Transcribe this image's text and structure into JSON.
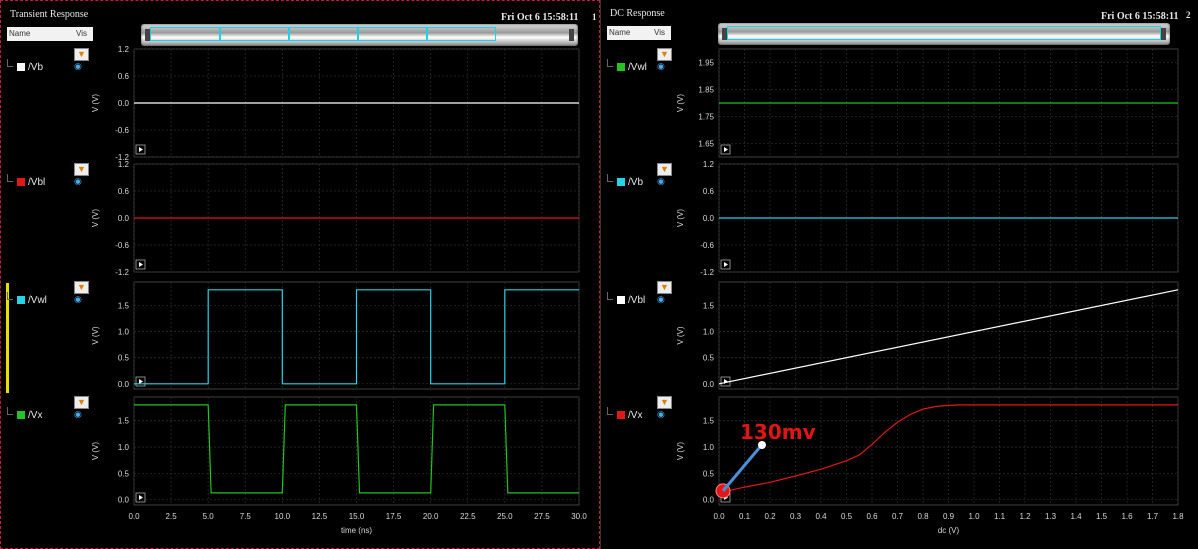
{
  "left": {
    "title": "Transient Response",
    "date": "Fri Oct 6 15:58:11",
    "header_name": "Name",
    "header_vis": "Vis",
    "signals": [
      {
        "name": "/Vb",
        "color": "#ffffff"
      },
      {
        "name": "/Vbl",
        "color": "#e01818"
      },
      {
        "name": "/Vwl",
        "color": "#27d3e6"
      },
      {
        "name": "/Vx",
        "color": "#21c421"
      }
    ]
  },
  "right": {
    "title": "DC Response",
    "date": "Fri Oct 6 15:58:11",
    "header_name": "Name",
    "header_vis": "Vis",
    "signals": [
      {
        "name": "/Vwl",
        "color": "#21c421"
      },
      {
        "name": "/Vb",
        "color": "#27d3e6"
      },
      {
        "name": "/Vbl",
        "color": "#ffffff"
      },
      {
        "name": "/Vx",
        "color": "#e01818"
      }
    ]
  },
  "divider_label": "1",
  "corner_label": "2",
  "annotation": "130mv",
  "chart_data": [
    {
      "type": "line",
      "title": "Transient Response",
      "xlabel": "time (ns)",
      "xlim": [
        0,
        30
      ],
      "xticks": [
        "0.0",
        "2.5",
        "5.0",
        "7.5",
        "10.0",
        "12.5",
        "15.0",
        "17.5",
        "20.0",
        "22.5",
        "25.0",
        "27.5",
        "30.0"
      ],
      "panels": [
        {
          "signal": "/Vb",
          "ylabel": "V (V)",
          "ylim": [
            -1.2,
            1.2
          ],
          "yticks": [
            "1.2",
            "0.6",
            "0.0",
            "-0.6",
            "-1.2"
          ],
          "color": "#ffffff",
          "x": [
            0,
            30
          ],
          "y": [
            0.0,
            0.0
          ]
        },
        {
          "signal": "/Vbl",
          "ylabel": "V (V)",
          "ylim": [
            -1.2,
            1.2
          ],
          "yticks": [
            "1.2",
            "0.6",
            "0.0",
            "-0.6",
            "-1.2"
          ],
          "color": "#e01818",
          "x": [
            0,
            30
          ],
          "y": [
            0.0,
            0.0
          ]
        },
        {
          "signal": "/Vwl",
          "ylabel": "V (V)",
          "ylim": [
            -0.1,
            1.95
          ],
          "yticks": [
            "1.5",
            "1.0",
            "0.5",
            "0.0"
          ],
          "color": "#27d3e6",
          "x": [
            0,
            5,
            5,
            10,
            10,
            15,
            15,
            20,
            20,
            25,
            25,
            30
          ],
          "y": [
            0,
            0,
            1.8,
            1.8,
            0,
            0,
            1.8,
            1.8,
            0,
            0,
            1.8,
            1.8
          ]
        },
        {
          "signal": "/Vx",
          "ylabel": "V (V)",
          "ylim": [
            -0.1,
            1.95
          ],
          "yticks": [
            "1.5",
            "1.0",
            "0.5",
            "0.0"
          ],
          "color": "#21c421",
          "x": [
            0,
            5,
            5.2,
            10,
            10.2,
            15,
            15.2,
            20,
            20.2,
            25,
            25.2,
            30
          ],
          "y": [
            1.8,
            1.8,
            0.13,
            0.13,
            1.8,
            1.8,
            0.13,
            0.13,
            1.8,
            1.8,
            0.13,
            0.13
          ]
        }
      ]
    },
    {
      "type": "line",
      "title": "DC Response",
      "xlabel": "dc (V)",
      "xlim": [
        0,
        1.8
      ],
      "xticks": [
        "0.0",
        "0.1",
        "0.2",
        "0.3",
        "0.4",
        "0.5",
        "0.6",
        "0.7",
        "0.8",
        "0.9",
        "1.0",
        "1.1",
        "1.2",
        "1.3",
        "1.4",
        "1.5",
        "1.6",
        "1.7",
        "1.8"
      ],
      "panels": [
        {
          "signal": "/Vwl",
          "ylabel": "V (V)",
          "ylim": [
            1.6,
            2.0
          ],
          "yticks": [
            "1.95",
            "1.85",
            "1.75",
            "1.65"
          ],
          "color": "#21c421",
          "x": [
            0,
            1.8
          ],
          "y": [
            1.8,
            1.8
          ]
        },
        {
          "signal": "/Vb",
          "ylabel": "V (V)",
          "ylim": [
            -1.2,
            1.2
          ],
          "yticks": [
            "1.2",
            "0.6",
            "0.0",
            "-0.6",
            "-1.2"
          ],
          "color": "#27d3e6",
          "x": [
            0,
            1.8
          ],
          "y": [
            0.0,
            0.0
          ]
        },
        {
          "signal": "/Vbl",
          "ylabel": "V (V)",
          "ylim": [
            -0.1,
            1.95
          ],
          "yticks": [
            "1.5",
            "1.0",
            "0.5",
            "0.0"
          ],
          "color": "#ffffff",
          "x": [
            0,
            1.8
          ],
          "y": [
            0.0,
            1.8
          ]
        },
        {
          "signal": "/Vx",
          "ylabel": "V (V)",
          "ylim": [
            -0.1,
            1.95
          ],
          "yticks": [
            "1.5",
            "1.0",
            "0.5",
            "0.0"
          ],
          "color": "#e01818",
          "x": [
            0,
            0.1,
            0.2,
            0.3,
            0.4,
            0.5,
            0.55,
            0.6,
            0.65,
            0.7,
            0.75,
            0.8,
            0.85,
            0.9,
            0.95,
            1.0,
            1.2,
            1.5,
            1.8
          ],
          "y": [
            0.13,
            0.24,
            0.33,
            0.45,
            0.58,
            0.74,
            0.85,
            1.05,
            1.28,
            1.47,
            1.62,
            1.72,
            1.77,
            1.79,
            1.8,
            1.8,
            1.8,
            1.8,
            1.8
          ]
        }
      ]
    }
  ]
}
